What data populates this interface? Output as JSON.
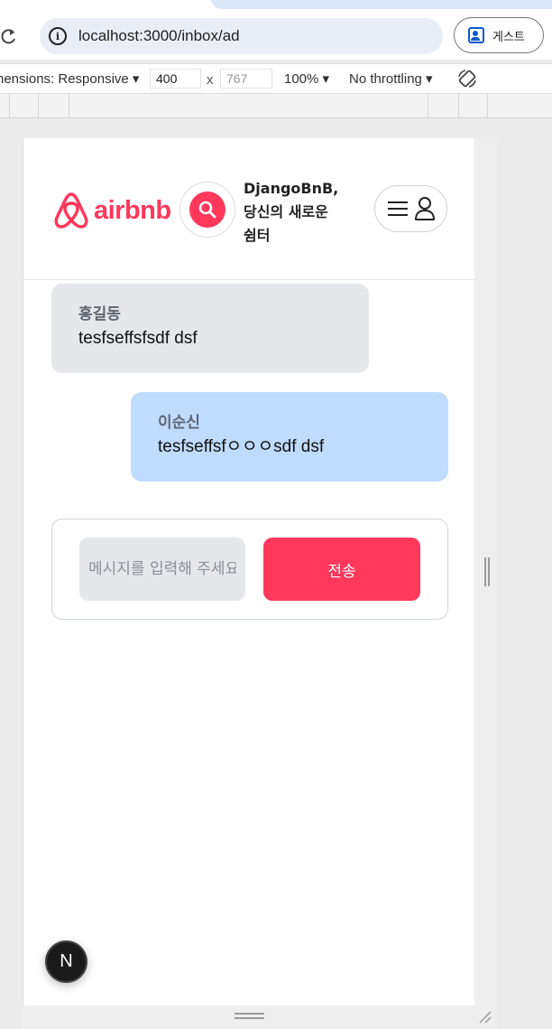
{
  "browser": {
    "url": "localhost:3000/inbox/ad",
    "guest_label": "게스트"
  },
  "devtools": {
    "dimensions_label": "nensions: Responsive",
    "width_value": "400",
    "times": "x",
    "height_placeholder": "767",
    "zoom": "100%",
    "throttling": "No throttling"
  },
  "navbar": {
    "logo_text": "airbnb",
    "tagline_line1": "DjangoBnB,",
    "tagline_line2": "당신의 새로운",
    "tagline_line3": "쉼터",
    "brand_color": "#ff385c"
  },
  "messages": [
    {
      "sender": "홍길동",
      "text": "tesfseffsfsdf dsf",
      "side": "left"
    },
    {
      "sender": "이순신",
      "text": "tesfseffsfㅇㅇㅇsdf dsf",
      "side": "right"
    }
  ],
  "composer": {
    "placeholder": "메시지를 입력해 주세요",
    "send_label": "전송"
  },
  "next_badge": "N"
}
